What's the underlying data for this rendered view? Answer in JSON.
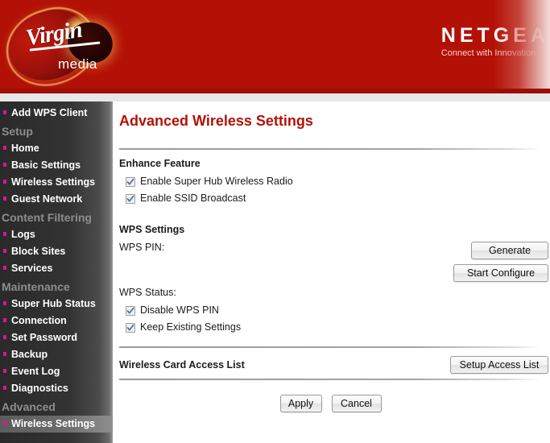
{
  "header": {
    "brand_primary": "Virgin",
    "brand_primary_sub": "media",
    "brand_secondary": "NETGEAR",
    "brand_secondary_tagline": "Connect with Innovation",
    "red": "#b31106"
  },
  "sidebar": {
    "items": [
      {
        "type": "link",
        "label": "Add WPS Client",
        "selected": false
      },
      {
        "type": "heading",
        "label": "Setup"
      },
      {
        "type": "link",
        "label": "Home",
        "selected": false
      },
      {
        "type": "link",
        "label": "Basic Settings",
        "selected": false
      },
      {
        "type": "link",
        "label": "Wireless Settings",
        "selected": false
      },
      {
        "type": "link",
        "label": "Guest Network",
        "selected": false
      },
      {
        "type": "heading",
        "label": "Content Filtering"
      },
      {
        "type": "link",
        "label": "Logs",
        "selected": false
      },
      {
        "type": "link",
        "label": "Block Sites",
        "selected": false
      },
      {
        "type": "link",
        "label": "Services",
        "selected": false
      },
      {
        "type": "heading",
        "label": "Maintenance"
      },
      {
        "type": "link",
        "label": "Super Hub Status",
        "selected": false
      },
      {
        "type": "link",
        "label": "Connection",
        "selected": false
      },
      {
        "type": "link",
        "label": "Set Password",
        "selected": false
      },
      {
        "type": "link",
        "label": "Backup",
        "selected": false
      },
      {
        "type": "link",
        "label": "Event Log",
        "selected": false
      },
      {
        "type": "link",
        "label": "Diagnostics",
        "selected": false
      },
      {
        "type": "heading",
        "label": "Advanced"
      },
      {
        "type": "link",
        "label": "Wireless Settings",
        "selected": true
      }
    ]
  },
  "main": {
    "title": "Advanced Wireless Settings",
    "enhance_feature": {
      "label": "Enhance Feature",
      "checkboxes": [
        {
          "label": "Enable Super Hub Wireless Radio",
          "checked": true
        },
        {
          "label": "Enable SSID Broadcast",
          "checked": true
        }
      ]
    },
    "wps_settings": {
      "label": "WPS Settings",
      "pin_label": "WPS PIN:",
      "pin_value": "",
      "generate_button": "Generate",
      "start_configure_button": "Start Configure",
      "status_label": "WPS Status:",
      "checkboxes": [
        {
          "label": "Disable WPS PIN",
          "checked": true
        },
        {
          "label": "Keep Existing Settings",
          "checked": true
        }
      ]
    },
    "access_list": {
      "label": "Wireless Card Access List",
      "button": "Setup Access List"
    },
    "actions": {
      "apply": "Apply",
      "cancel": "Cancel"
    }
  }
}
